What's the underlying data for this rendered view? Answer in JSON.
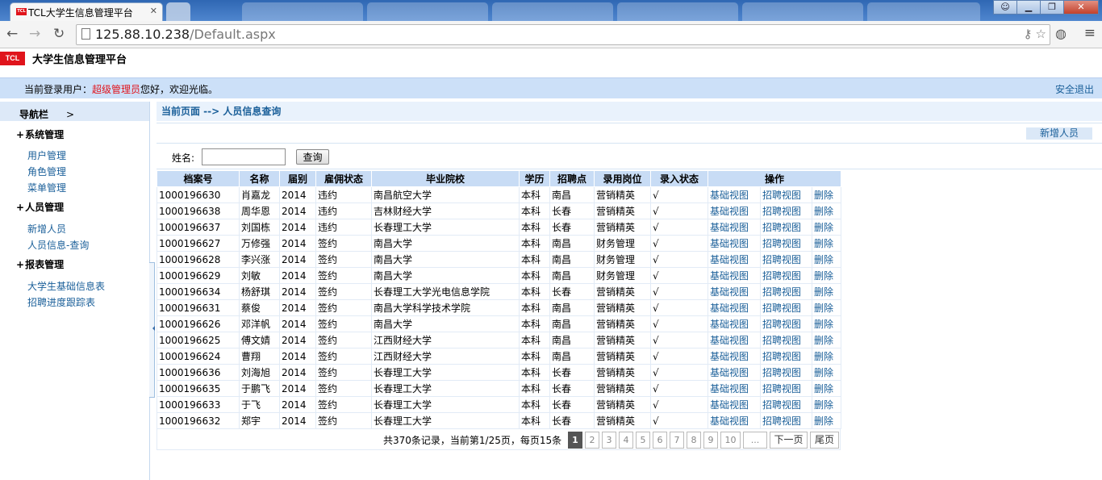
{
  "browser": {
    "tab_title": "TCL大学生信息管理平台",
    "tab_favicon": "TCL",
    "url_host": "125.88.10.238",
    "url_path": "/Default.aspx"
  },
  "header": {
    "logo": "TCL",
    "site_title": "大学生信息管理平台",
    "login_prefix": "当前登录用户：",
    "login_user": "超级管理员",
    "login_suffix": "您好，欢迎光临。",
    "logout": "安全退出"
  },
  "sidebar": {
    "title": "导航栏",
    "chevron": ">",
    "groups": [
      {
        "label": "系统管理",
        "items": [
          "用户管理",
          "角色管理",
          "菜单管理"
        ]
      },
      {
        "label": "人员管理",
        "items": [
          "新增人员",
          "人员信息-查询"
        ]
      },
      {
        "label": "报表管理",
        "items": [
          "大学生基础信息表",
          "招聘进度跟踪表"
        ]
      }
    ]
  },
  "main": {
    "breadcrumb": "当前页面 --> 人员信息查询",
    "new_button": "新增人员",
    "search_label": "姓名:",
    "search_value": "",
    "search_button": "查询",
    "columns": [
      "档案号",
      "名称",
      "届别",
      "雇佣状态",
      "毕业院校",
      "学历",
      "招聘点",
      "录用岗位",
      "录入状态",
      "操作"
    ],
    "actions": [
      "基础视图",
      "招聘视图",
      "删除"
    ],
    "rows": [
      [
        "1000196630",
        "肖嘉龙",
        "2014",
        "违约",
        "南昌航空大学",
        "本科",
        "南昌",
        "营销精英",
        "√"
      ],
      [
        "1000196638",
        "周华恩",
        "2014",
        "违约",
        "吉林财经大学",
        "本科",
        "长春",
        "营销精英",
        "√"
      ],
      [
        "1000196637",
        "刘国栋",
        "2014",
        "违约",
        "长春理工大学",
        "本科",
        "长春",
        "营销精英",
        "√"
      ],
      [
        "1000196627",
        "万修强",
        "2014",
        "签约",
        "南昌大学",
        "本科",
        "南昌",
        "财务管理",
        "√"
      ],
      [
        "1000196628",
        "李兴涨",
        "2014",
        "签约",
        "南昌大学",
        "本科",
        "南昌",
        "财务管理",
        "√"
      ],
      [
        "1000196629",
        "刘敏",
        "2014",
        "签约",
        "南昌大学",
        "本科",
        "南昌",
        "财务管理",
        "√"
      ],
      [
        "1000196634",
        "杨舒琪",
        "2014",
        "签约",
        "长春理工大学光电信息学院",
        "本科",
        "长春",
        "营销精英",
        "√"
      ],
      [
        "1000196631",
        "蔡俊",
        "2014",
        "签约",
        "南昌大学科学技术学院",
        "本科",
        "南昌",
        "营销精英",
        "√"
      ],
      [
        "1000196626",
        "邓洋帆",
        "2014",
        "签约",
        "南昌大学",
        "本科",
        "南昌",
        "营销精英",
        "√"
      ],
      [
        "1000196625",
        "傅文婧",
        "2014",
        "签约",
        "江西财经大学",
        "本科",
        "南昌",
        "营销精英",
        "√"
      ],
      [
        "1000196624",
        "曹翔",
        "2014",
        "签约",
        "江西财经大学",
        "本科",
        "南昌",
        "营销精英",
        "√"
      ],
      [
        "1000196636",
        "刘海旭",
        "2014",
        "签约",
        "长春理工大学",
        "本科",
        "长春",
        "营销精英",
        "√"
      ],
      [
        "1000196635",
        "于鹏飞",
        "2014",
        "签约",
        "长春理工大学",
        "本科",
        "长春",
        "营销精英",
        "√"
      ],
      [
        "1000196633",
        "于飞",
        "2014",
        "签约",
        "长春理工大学",
        "本科",
        "长春",
        "营销精英",
        "√"
      ],
      [
        "1000196632",
        "郑宇",
        "2014",
        "签约",
        "长春理工大学",
        "本科",
        "长春",
        "营销精英",
        "√"
      ]
    ],
    "pager": {
      "summary": "共370条记录，当前第1/25页，每页15条",
      "pages": [
        "1",
        "2",
        "3",
        "4",
        "5",
        "6",
        "7",
        "8",
        "9",
        "10",
        "..."
      ],
      "current": "1",
      "next": "下一页",
      "last": "尾页"
    }
  }
}
